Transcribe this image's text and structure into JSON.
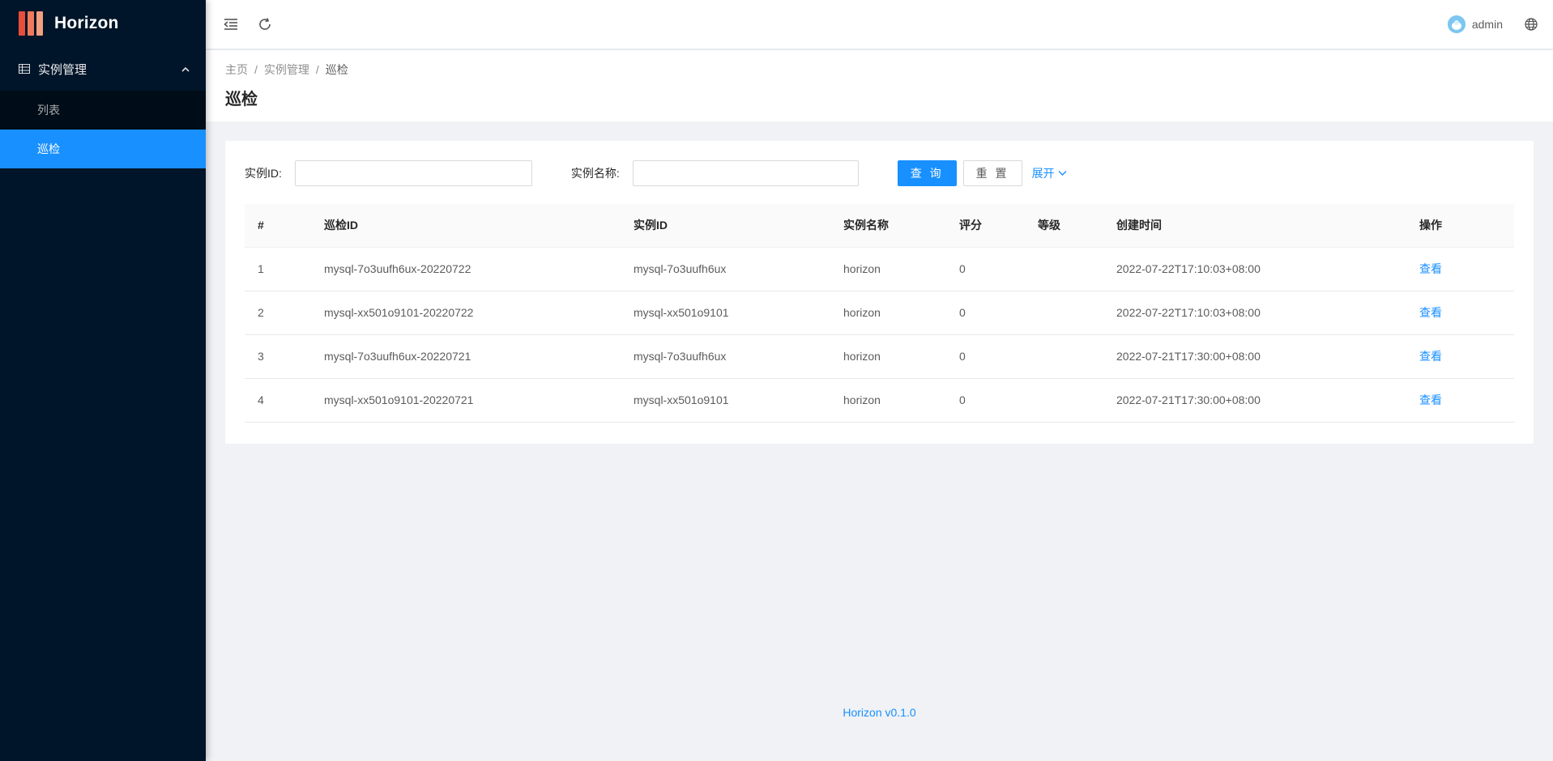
{
  "app": {
    "name": "Horizon"
  },
  "sidebar": {
    "group_label": "实例管理",
    "items": [
      {
        "label": "列表",
        "active": false
      },
      {
        "label": "巡检",
        "active": true
      }
    ]
  },
  "header": {
    "username": "admin"
  },
  "breadcrumb": [
    "主页",
    "实例管理",
    "巡检"
  ],
  "page_title": "巡检",
  "search": {
    "instance_id_label": "实例ID:",
    "instance_id_value": "",
    "instance_name_label": "实例名称:",
    "instance_name_value": "",
    "query_label": "查 询",
    "reset_label": "重 置",
    "expand_label": "展开"
  },
  "table": {
    "columns": [
      "#",
      "巡检ID",
      "实例ID",
      "实例名称",
      "评分",
      "等级",
      "创建时间",
      "操作"
    ],
    "rows": [
      {
        "index": "1",
        "inspection_id": "mysql-7o3uufh6ux-20220722",
        "instance_id": "mysql-7o3uufh6ux",
        "instance_name": "horizon",
        "score": "0",
        "level": "",
        "created": "2022-07-22T17:10:03+08:00",
        "action": "查看"
      },
      {
        "index": "2",
        "inspection_id": "mysql-xx501o9101-20220722",
        "instance_id": "mysql-xx501o9101",
        "instance_name": "horizon",
        "score": "0",
        "level": "",
        "created": "2022-07-22T17:10:03+08:00",
        "action": "查看"
      },
      {
        "index": "3",
        "inspection_id": "mysql-7o3uufh6ux-20220721",
        "instance_id": "mysql-7o3uufh6ux",
        "instance_name": "horizon",
        "score": "0",
        "level": "",
        "created": "2022-07-21T17:30:00+08:00",
        "action": "查看"
      },
      {
        "index": "4",
        "inspection_id": "mysql-xx501o9101-20220721",
        "instance_id": "mysql-xx501o9101",
        "instance_name": "horizon",
        "score": "0",
        "level": "",
        "created": "2022-07-21T17:30:00+08:00",
        "action": "查看"
      }
    ]
  },
  "footer": {
    "version_text": "Horizon v0.1.0"
  },
  "colors": {
    "primary": "#1890ff",
    "sidebar_bg": "#001529",
    "submenu_bg": "#000c17"
  },
  "icons": [
    "menu-fold-icon",
    "reload-icon",
    "avatar",
    "global-icon",
    "table-icon",
    "chevron-up-icon",
    "chevron-down-icon"
  ]
}
